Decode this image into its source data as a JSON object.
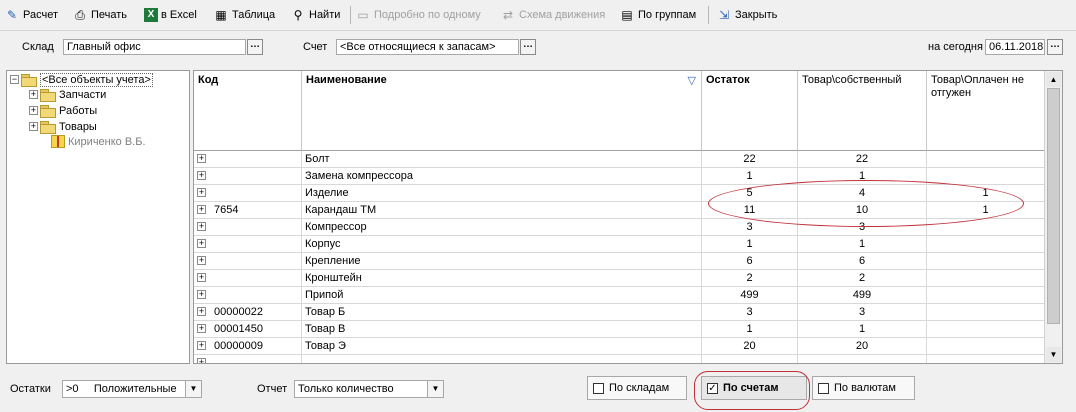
{
  "toolbar": {
    "items": [
      {
        "label": "Расчет",
        "icon": "calculator-icon"
      },
      {
        "label": "Печать",
        "icon": "printer-icon"
      },
      {
        "label": "в Excel",
        "icon": "excel-icon"
      },
      {
        "label": "Таблица",
        "icon": "table-icon"
      },
      {
        "label": "Найти",
        "icon": "search-icon"
      },
      {
        "label": "Подробно по одному",
        "icon": "details-icon",
        "disabled": true
      },
      {
        "label": "Схема движения",
        "icon": "flow-icon",
        "disabled": true
      },
      {
        "label": "По группам",
        "icon": "groups-icon"
      },
      {
        "label": "Закрыть",
        "icon": "close-icon"
      }
    ]
  },
  "filters": {
    "warehouse_label": "Склад",
    "warehouse_value": "Главный офис",
    "account_label": "Счет",
    "account_value": "<Все относящиеся к запасам>",
    "date_label": "на сегодня",
    "date_value": "06.11.2018"
  },
  "tree": {
    "root": "<Все объекты учета>",
    "items": [
      "Запчасти",
      "Работы",
      "Товары"
    ],
    "person": "Кириченко В.Б."
  },
  "grid": {
    "columns": [
      "Код",
      "Наименование",
      "Остаток",
      "Товар\\собственный",
      "Товар\\Оплачен не отгужен"
    ],
    "rows": [
      {
        "code": "",
        "name": "Болт",
        "balance": "22",
        "own": "22",
        "paid": ""
      },
      {
        "code": "",
        "name": "Замена компрессора",
        "balance": "1",
        "own": "1",
        "paid": ""
      },
      {
        "code": "",
        "name": "Изделие",
        "balance": "5",
        "own": "4",
        "paid": "1"
      },
      {
        "code": "7654",
        "name": "Карандаш ТМ",
        "balance": "11",
        "own": "10",
        "paid": "1"
      },
      {
        "code": "",
        "name": "Компрессор",
        "balance": "3",
        "own": "3",
        "paid": ""
      },
      {
        "code": "",
        "name": "Корпус",
        "balance": "1",
        "own": "1",
        "paid": ""
      },
      {
        "code": "",
        "name": "Крепление",
        "balance": "6",
        "own": "6",
        "paid": ""
      },
      {
        "code": "",
        "name": "Кронштейн",
        "balance": "2",
        "own": "2",
        "paid": ""
      },
      {
        "code": "",
        "name": "Припой",
        "balance": "499",
        "own": "499",
        "paid": ""
      },
      {
        "code": "00000022",
        "name": "Товар Б",
        "balance": "3",
        "own": "3",
        "paid": ""
      },
      {
        "code": "00001450",
        "name": "Товар В",
        "balance": "1",
        "own": "1",
        "paid": ""
      },
      {
        "code": "00000009",
        "name": "Товар Э",
        "balance": "20",
        "own": "20",
        "paid": ""
      }
    ]
  },
  "bottom": {
    "balances_label": "Остатки",
    "balances_value": ">0     Положительные",
    "report_label": "Отчет",
    "report_value": "Только количество",
    "by_warehouse": "По складам",
    "by_accounts": "По счетам",
    "by_currency": "По валютам"
  },
  "colors": {
    "highlight_oval": "#c0303a",
    "filter_icon": "#3060c0"
  }
}
